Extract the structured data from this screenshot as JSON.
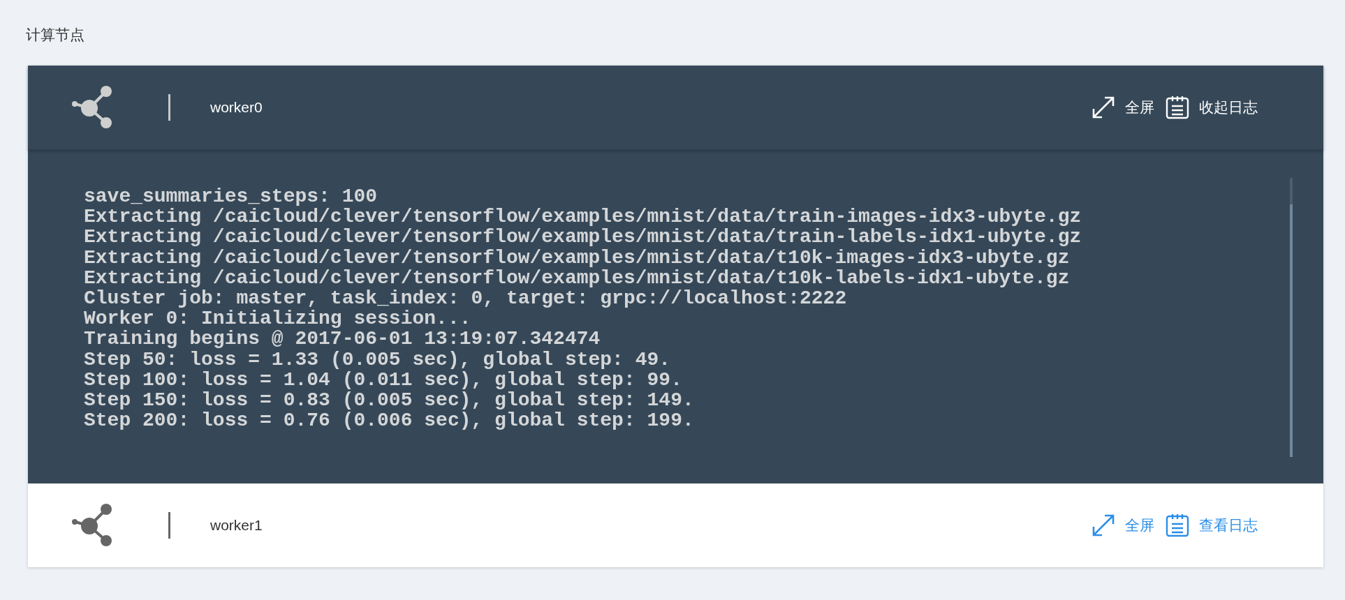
{
  "section_title": "计算节点",
  "workers": [
    {
      "name": "worker0",
      "expanded": true,
      "fullscreen_label": "全屏",
      "log_toggle_label": "收起日志",
      "log_lines": [
        "save_summaries_steps: 100",
        "Extracting /caicloud/clever/tensorflow/examples/mnist/data/train-images-idx3-ubyte.gz",
        "Extracting /caicloud/clever/tensorflow/examples/mnist/data/train-labels-idx1-ubyte.gz",
        "Extracting /caicloud/clever/tensorflow/examples/mnist/data/t10k-images-idx3-ubyte.gz",
        "Extracting /caicloud/clever/tensorflow/examples/mnist/data/t10k-labels-idx1-ubyte.gz",
        "Cluster job: master, task_index: 0, target: grpc://localhost:2222",
        "Worker 0: Initializing session...",
        "Training begins @ 2017-06-01 13:19:07.342474",
        "Step 50: loss = 1.33 (0.005 sec), global step: 49.",
        "Step 100: loss = 1.04 (0.011 sec), global step: 99.",
        "Step 150: loss = 0.83 (0.005 sec), global step: 149.",
        "Step 200: loss = 0.76 (0.006 sec), global step: 199."
      ]
    },
    {
      "name": "worker1",
      "expanded": false,
      "fullscreen_label": "全屏",
      "log_toggle_label": "查看日志"
    }
  ]
}
